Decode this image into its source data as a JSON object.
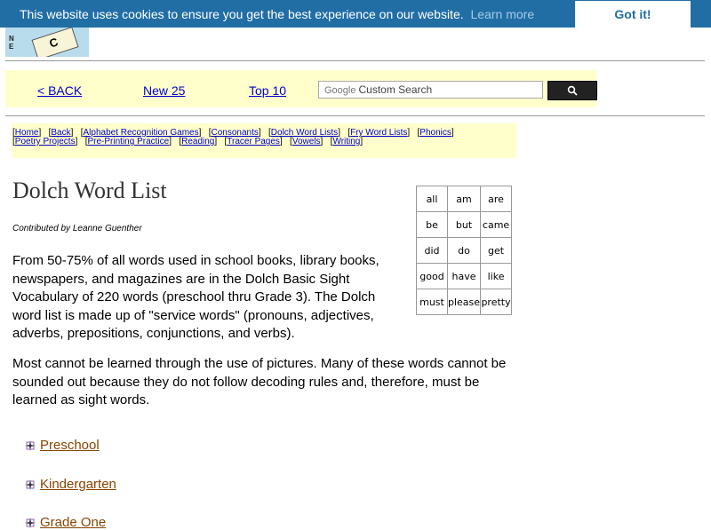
{
  "cookie": {
    "message": "This website uses cookies to ensure you get the best experience on our website.",
    "learn_more": "Learn more",
    "button": "Got it!"
  },
  "logo": {
    "letter": "C",
    "side_text": "N E"
  },
  "topbar": {
    "back": "< BACK",
    "new": "New 25",
    "top": "Top 10",
    "search_brand": "Google",
    "search_placeholder": "Custom Search"
  },
  "links": {
    "row1": [
      "Home",
      "Back",
      "Alphabet Recognition Games",
      "Consonants",
      "Dolch Word Lists",
      "Fry Word Lists",
      "Phonics"
    ],
    "row2": [
      "Poetry Projects",
      "Pre-Printing Practice",
      "Reading",
      "Tracer Pages",
      "Vowels",
      "Writing"
    ]
  },
  "page": {
    "title": "Dolch Word List",
    "contributor": "Contributed by Leanne Guenther",
    "para1": "From 50-75% of all words used in school books, library books, newspapers, and magazines are in the Dolch Basic Sight Vocabulary of 220 words (preschool thru Grade 3).  The Dolch word list is made up of \"service words\" (pronouns, adjectives, adverbs, prepositions, conjunctions, and verbs).",
    "para2": "Most cannot be learned through the use of pictures.   Many of these words cannot be sounded out because they do not follow decoding rules and, therefore, must be learned as sight words."
  },
  "words": [
    [
      "all",
      "am",
      "are"
    ],
    [
      "be",
      "but",
      "came"
    ],
    [
      "did",
      "do",
      "get"
    ],
    [
      "good",
      "have",
      "like"
    ],
    [
      "must",
      "please",
      "pretty"
    ]
  ],
  "grades": [
    "Preschool",
    "Kindergarten",
    "Grade One"
  ]
}
